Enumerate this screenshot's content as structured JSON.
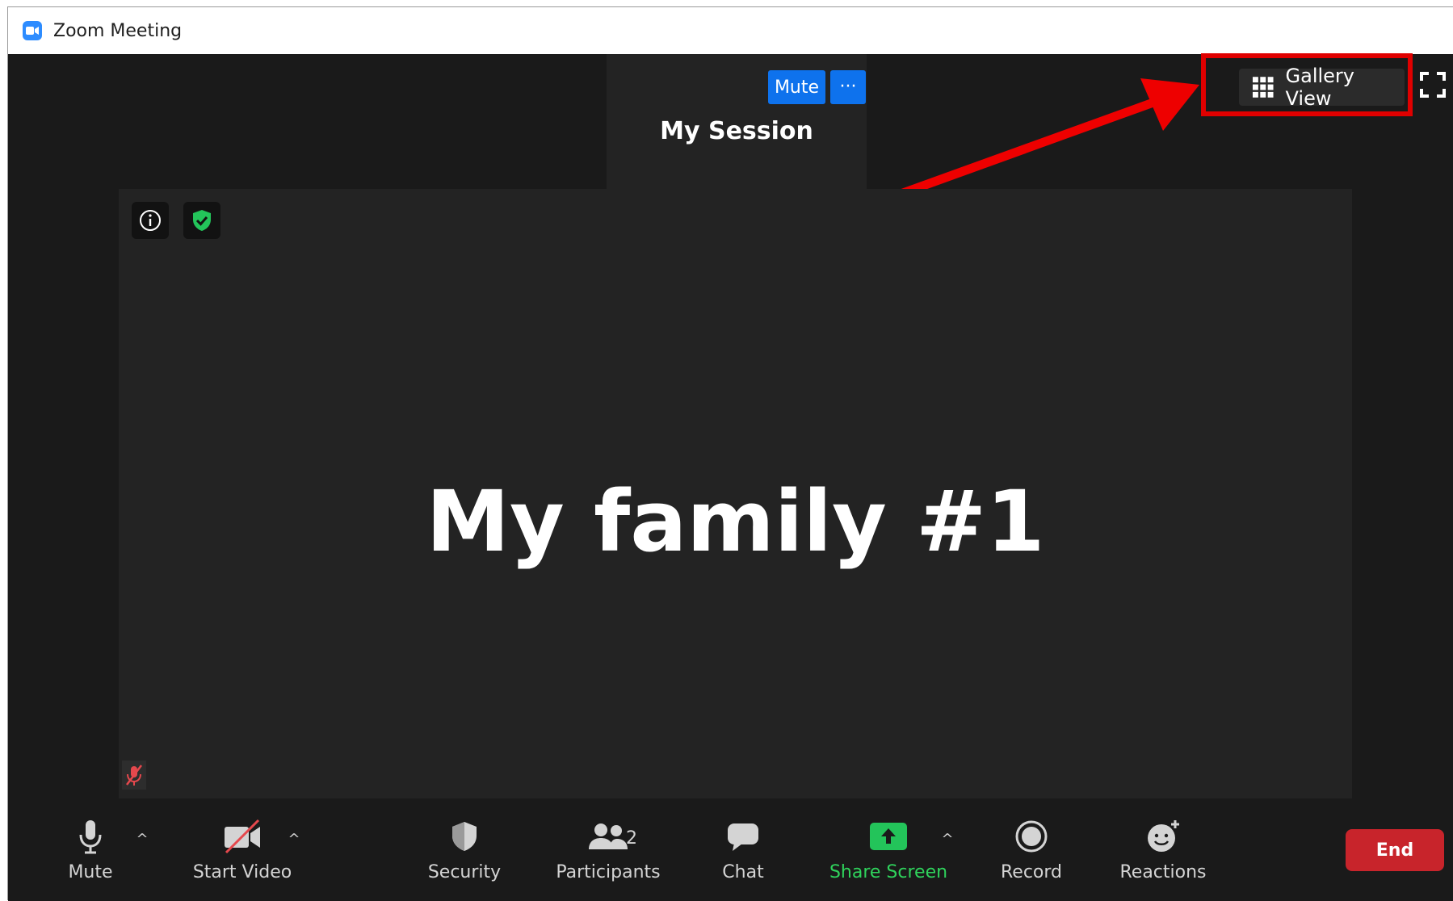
{
  "window": {
    "title": "Zoom Meeting"
  },
  "top_panel": {
    "mute_label": "Mute",
    "more_label": "···",
    "session_name": "My Session"
  },
  "view": {
    "gallery_label": "Gallery View"
  },
  "main_video": {
    "participant_name": "My family #1"
  },
  "toolbar": {
    "mute_label": "Mute",
    "start_video_label": "Start Video",
    "security_label": "Security",
    "participants_label": "Participants",
    "participants_count": "2",
    "chat_label": "Chat",
    "share_screen_label": "Share Screen",
    "record_label": "Record",
    "reactions_label": "Reactions",
    "end_label": "End"
  },
  "colors": {
    "accent_blue": "#0e72ed",
    "share_green": "#2fd35c",
    "end_red": "#c8242b",
    "highlight_red": "#e00000",
    "background": "#1a1a1a"
  }
}
